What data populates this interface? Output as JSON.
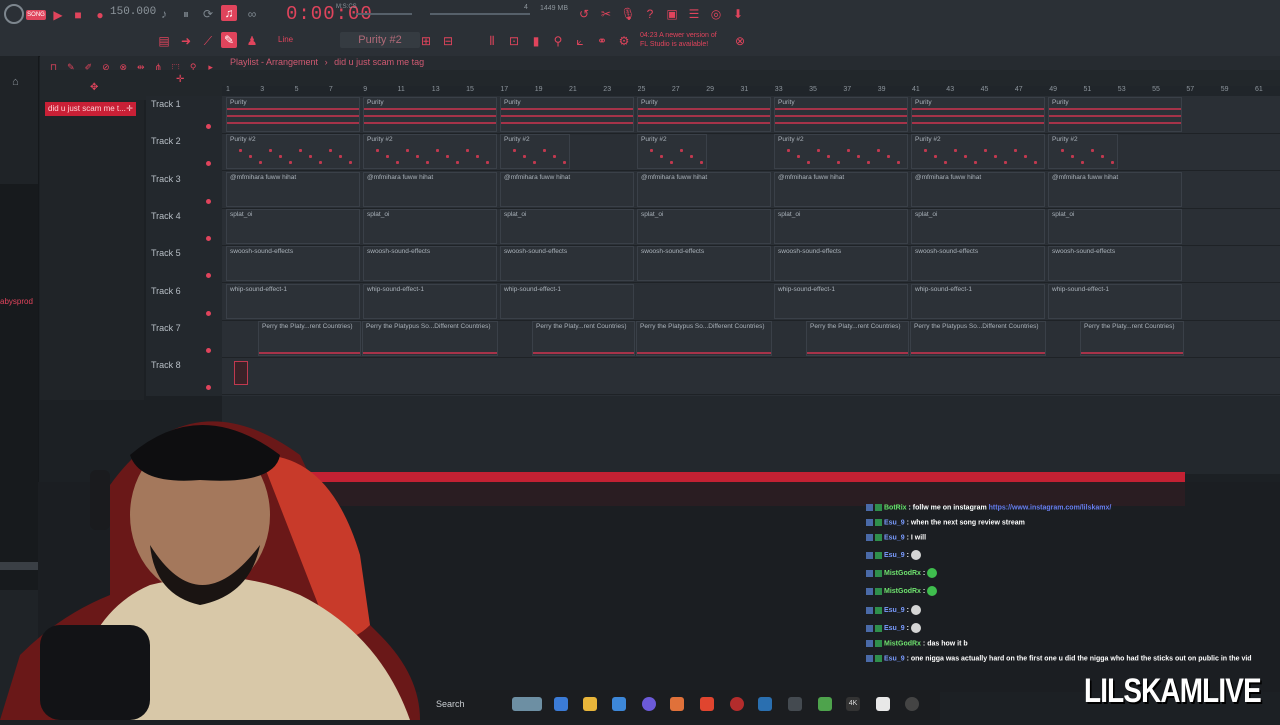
{
  "toolbar": {
    "song_mode": "SONG",
    "tempo": "150.000",
    "time": "0:00:00",
    "time_unit": "M:S:CS",
    "memory": "1449 MB",
    "cpu": "4",
    "pattern": "Purity #2",
    "snap_mode": "Line",
    "news": [
      "04:23 A newer version of",
      "FL Studio is available!"
    ]
  },
  "browser": {
    "label": "abysprod"
  },
  "playlist": {
    "title": "Playlist - Arrangement",
    "separator": "›",
    "pattern_name": "did u just scam me tag",
    "picker_selected": "did u just scam me t...",
    "ruler": [
      "1",
      "3",
      "5",
      "7",
      "9",
      "11",
      "13",
      "15",
      "17",
      "19",
      "21",
      "23",
      "25",
      "27",
      "29",
      "31",
      "33",
      "35",
      "37",
      "39",
      "41",
      "43",
      "45",
      "47",
      "49",
      "51",
      "53",
      "55",
      "57",
      "59",
      "61"
    ],
    "tracks": [
      {
        "label": "Track 1",
        "clip": "Purity"
      },
      {
        "label": "Track 2",
        "clip": "Purity #2"
      },
      {
        "label": "Track 3",
        "clip": "@mfmihara fuww hihat"
      },
      {
        "label": "Track 4",
        "clip": "splat_oi"
      },
      {
        "label": "Track 5",
        "clip": "swoosh-sound-effects"
      },
      {
        "label": "Track 6",
        "clip": "whip-sound-effect-1"
      },
      {
        "label": "Track 7",
        "clip_short": "Perry the Platy...rent Countries)",
        "clip_long": "Perry the Platypus So...Different Countries)"
      },
      {
        "label": "Track 8",
        "clip": ""
      }
    ]
  },
  "chat": [
    {
      "user": "BotRix",
      "message": "follw me on instagram",
      "link": "https://www.instagram.com/lilskamx/"
    },
    {
      "user": "Esu_9",
      "message": "when the next song review stream"
    },
    {
      "user": "Esu_9",
      "message": "I will"
    },
    {
      "user": "Esu_9",
      "message": "",
      "emote": "skull-emote"
    },
    {
      "user": "MistGodRx",
      "message": "",
      "emote": "green-emote"
    },
    {
      "user": "MistGodRx",
      "message": "",
      "emote": "green-emote"
    },
    {
      "user": "Esu_9",
      "message": "",
      "emote": "skull-emote"
    },
    {
      "user": "Esu_9",
      "message": "",
      "emote": "skull-emote"
    },
    {
      "user": "MistGodRx",
      "message": "das how it b"
    },
    {
      "user": "Esu_9",
      "message": "one nigga was actually hard on the first one u did the nigga who had the sticks out on public in the vid"
    }
  ],
  "taskbar": {
    "search": "Search"
  },
  "overlay": {
    "brand": "LILSKAMLIVE"
  },
  "colors": {
    "accent": "#e0445c",
    "band": "#c32133",
    "bg": "#2a2f35"
  }
}
